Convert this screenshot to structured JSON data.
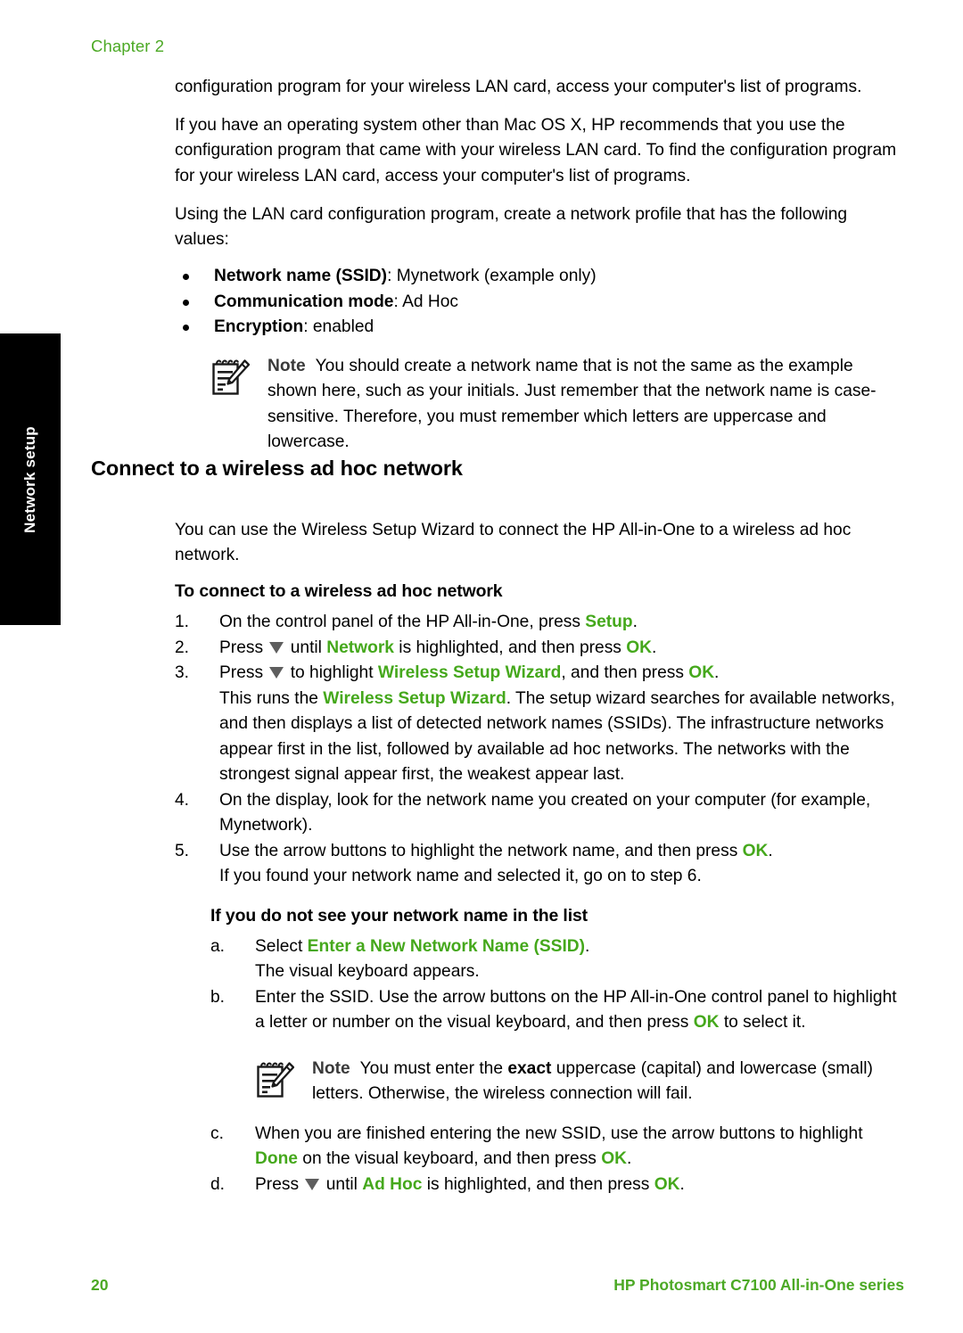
{
  "chapter_header": "Chapter 2",
  "side_tab": {
    "label": "Network setup"
  },
  "intro": {
    "p1": "configuration program for your wireless LAN card, access your computer's list of programs.",
    "p2": "If you have an operating system other than Mac OS X, HP recommends that you use the configuration program that came with your wireless LAN card. To find the configuration program for your wireless LAN card, access your computer's list of programs.",
    "p3": "Using the LAN card configuration program, create a network profile that has the following values:"
  },
  "profile_values": [
    {
      "label": "Network name (SSID)",
      "sep": ": ",
      "value": "Mynetwork (example only)"
    },
    {
      "label": "Communication mode",
      "sep": ": ",
      "value": "Ad Hoc"
    },
    {
      "label": "Encryption",
      "sep": ": ",
      "value": "enabled"
    }
  ],
  "note1": {
    "icon": "note-pad-pencil-icon",
    "label": "Note",
    "text": "You should create a network name that is not the same as the example shown here, such as your initials. Just remember that the network name is case-sensitive. Therefore, you must remember which letters are uppercase and lowercase."
  },
  "section": {
    "heading": "Connect to a wireless ad hoc network",
    "intro": "You can use the Wireless Setup Wizard to connect the HP All-in-One to a wireless ad hoc network.",
    "procedure_title": "To connect to a wireless ad hoc network"
  },
  "steps": [
    {
      "marker": "1.",
      "parts": [
        {
          "t": "On the control panel of the HP All-in-One, press ",
          "style": "plain"
        },
        {
          "t": "Setup",
          "style": "ui"
        },
        {
          "t": ".",
          "style": "plain"
        }
      ]
    },
    {
      "marker": "2.",
      "parts": [
        {
          "t": "Press ",
          "style": "plain"
        },
        {
          "t": "",
          "style": "arrow"
        },
        {
          "t": " until ",
          "style": "plain"
        },
        {
          "t": "Network",
          "style": "ui"
        },
        {
          "t": " is highlighted, and then press ",
          "style": "plain"
        },
        {
          "t": "OK",
          "style": "ui"
        },
        {
          "t": ".",
          "style": "plain"
        }
      ]
    },
    {
      "marker": "3.",
      "parts": [
        {
          "t": "Press ",
          "style": "plain"
        },
        {
          "t": "",
          "style": "arrow"
        },
        {
          "t": " to highlight ",
          "style": "plain"
        },
        {
          "t": "Wireless Setup Wizard",
          "style": "ui"
        },
        {
          "t": ", and then press ",
          "style": "plain"
        },
        {
          "t": "OK",
          "style": "ui"
        },
        {
          "t": ".",
          "style": "plain"
        }
      ],
      "extra_parts": [
        {
          "t": "This runs the ",
          "style": "plain"
        },
        {
          "t": "Wireless Setup Wizard",
          "style": "ui"
        },
        {
          "t": ". The setup wizard searches for available networks, and then displays a list of detected network names (SSIDs). The infrastructure networks appear first in the list, followed by available ad hoc networks. The networks with the strongest signal appear first, the weakest appear last.",
          "style": "plain"
        }
      ]
    },
    {
      "marker": "4.",
      "parts": [
        {
          "t": "On the display, look for the network name you created on your computer (for example, Mynetwork).",
          "style": "plain"
        }
      ]
    },
    {
      "marker": "5.",
      "parts": [
        {
          "t": "Use the arrow buttons to highlight the network name, and then press ",
          "style": "plain"
        },
        {
          "t": "OK",
          "style": "ui"
        },
        {
          "t": ".",
          "style": "plain"
        }
      ],
      "extra_parts": [
        {
          "t": "If you found your network name and selected it, go on to step 6.",
          "style": "plain"
        }
      ]
    }
  ],
  "subsection": {
    "title": "If you do not see your network name in the list",
    "substeps": [
      {
        "marker": "a.",
        "parts": [
          {
            "t": "Select ",
            "style": "plain"
          },
          {
            "t": "Enter a New Network Name (SSID)",
            "style": "ui"
          },
          {
            "t": ".",
            "style": "plain"
          }
        ],
        "extra_parts": [
          {
            "t": "The visual keyboard appears.",
            "style": "plain"
          }
        ]
      },
      {
        "marker": "b.",
        "parts": [
          {
            "t": "Enter the SSID. Use the arrow buttons on the HP All-in-One control panel to highlight a letter or number on the visual keyboard, and then press ",
            "style": "plain"
          },
          {
            "t": "OK",
            "style": "ui"
          },
          {
            "t": " to select it.",
            "style": "plain"
          }
        ]
      }
    ],
    "note2": {
      "icon": "note-pad-pencil-icon",
      "label": "Note",
      "parts": [
        {
          "t": "You must enter the ",
          "style": "plain"
        },
        {
          "t": "exact",
          "style": "bold"
        },
        {
          "t": " uppercase (capital) and lowercase (small) letters. Otherwise, the wireless connection will fail.",
          "style": "plain"
        }
      ]
    },
    "substeps2": [
      {
        "marker": "c.",
        "parts": [
          {
            "t": "When you are finished entering the new SSID, use the arrow buttons to highlight ",
            "style": "plain"
          },
          {
            "t": "Done",
            "style": "ui"
          },
          {
            "t": " on the visual keyboard, and then press ",
            "style": "plain"
          },
          {
            "t": "OK",
            "style": "ui"
          },
          {
            "t": ".",
            "style": "plain"
          }
        ]
      },
      {
        "marker": "d.",
        "parts": [
          {
            "t": "Press ",
            "style": "plain"
          },
          {
            "t": "",
            "style": "arrow"
          },
          {
            "t": " until ",
            "style": "plain"
          },
          {
            "t": "Ad Hoc",
            "style": "ui"
          },
          {
            "t": " is highlighted, and then press ",
            "style": "plain"
          },
          {
            "t": "OK",
            "style": "ui"
          },
          {
            "t": ".",
            "style": "plain"
          }
        ]
      }
    ]
  },
  "footer": {
    "page_number": "20",
    "product": "HP Photosmart C7100 All-in-One series"
  },
  "colors": {
    "accent_green": "#45A81C",
    "header_green": "#4CA925",
    "arrow_gray": "#5E5E5E",
    "note_label_gray": "#3A3A3A",
    "tab_background": "#000000"
  }
}
